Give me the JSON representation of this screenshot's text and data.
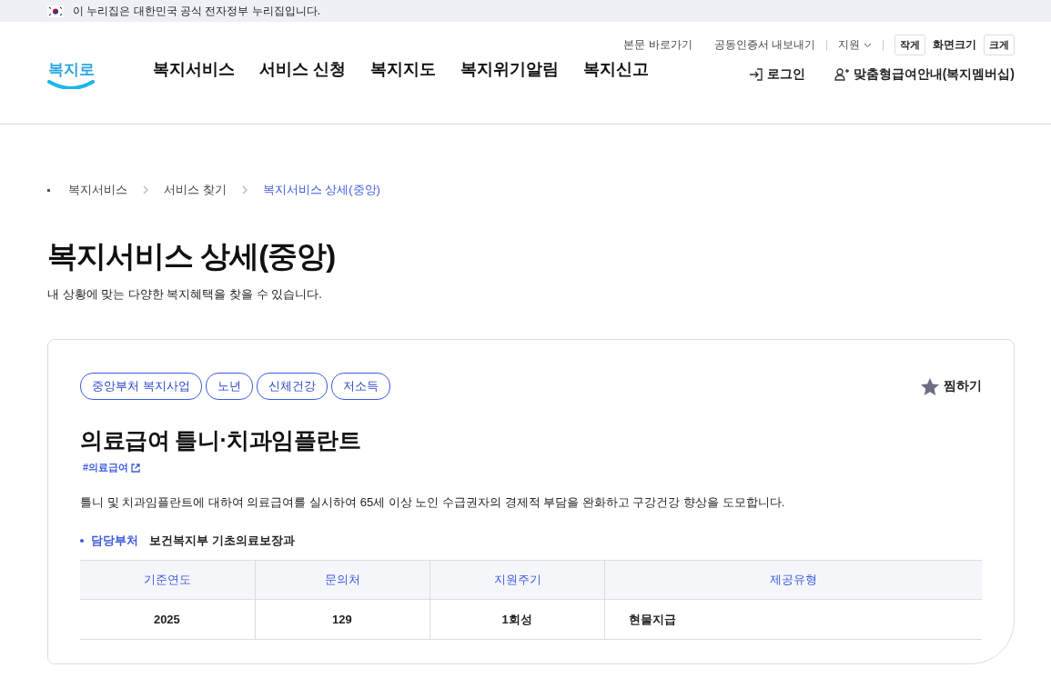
{
  "gov_banner": {
    "text": "이 누리집은 대한민국 공식 전자정부 누리집입니다."
  },
  "utility_links": [
    {
      "label": "본문 바로가기"
    },
    {
      "label": "공동인증서 내보내기"
    }
  ],
  "support_menu": {
    "label": "지원"
  },
  "font_size": {
    "smaller": "작게",
    "label": "화면크기",
    "larger": "크게"
  },
  "logo": {
    "text": "복지로"
  },
  "nav": [
    {
      "label": "복지서비스"
    },
    {
      "label": "서비스 신청"
    },
    {
      "label": "복지지도"
    },
    {
      "label": "복지위기알림"
    },
    {
      "label": "복지신고"
    }
  ],
  "login": {
    "label": "로그인"
  },
  "membership": {
    "label": "맞춤형급여안내(복지멤버십)"
  },
  "breadcrumbs": [
    {
      "label": "복지서비스",
      "selected": false
    },
    {
      "label": "서비스 찾기",
      "selected": false
    },
    {
      "label": "복지서비스 상세(중앙)",
      "selected": true
    }
  ],
  "page_title": "복지서비스 상세(중앙)",
  "page_subtitle": "내 상황에 맞는 다양한 복지혜택을 찾을 수 있습니다.",
  "service": {
    "tags": [
      "중앙부처 복지사업",
      "노년",
      "신체건강",
      "저소득"
    ],
    "favorite": {
      "label": "찜하기",
      "selected": false
    },
    "title": "의료급여 틀니·치과임플란트",
    "hashtag": "#의료급여",
    "description": "틀니 및 치과임플란트에 대하여 의료급여를 실시하여 65세 이상 노인 수급권자의 경제적 부담을 완화하고 구강건강 향상을 도모합니다.",
    "department": {
      "label": "담당부처",
      "value": "보건복지부 기초의료보장과"
    },
    "table": {
      "columns": [
        "기준연도",
        "문의처",
        "지원주기",
        "제공유형"
      ],
      "rows": [
        [
          "2025",
          "129",
          "1회성",
          "현물지급"
        ]
      ]
    }
  }
}
